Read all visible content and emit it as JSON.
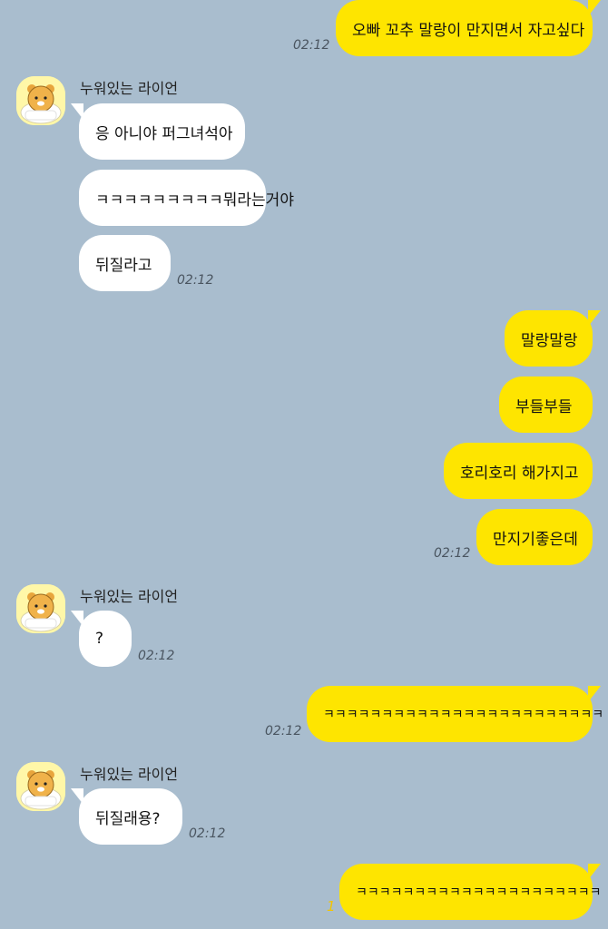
{
  "contact": {
    "name": "누워있는 라이언"
  },
  "messages": [
    {
      "from": "me",
      "text": "오빠 꼬추 말랑이 만지면서 자고싶다",
      "time": "02:12"
    },
    {
      "from": "them",
      "text": "응 아니야 퍼그녀석아"
    },
    {
      "from": "them",
      "text": "ㅋㅋㅋㅋㅋㅋㅋㅋㅋ뭐라는거야"
    },
    {
      "from": "them",
      "text": "뒤질라고",
      "time": "02:12"
    },
    {
      "from": "me",
      "text": "말랑말랑"
    },
    {
      "from": "me",
      "text": "부들부들"
    },
    {
      "from": "me",
      "text": "호리호리 해가지고"
    },
    {
      "from": "me",
      "text": "만지기좋은데",
      "time": "02:12"
    },
    {
      "from": "them",
      "text": "?",
      "time": "02:12"
    },
    {
      "from": "me",
      "text": "ㅋㅋㅋㅋㅋㅋㅋㅋㅋㅋㅋㅋㅋㅋㅋㅋㅋㅋㅋㅋㅋㅋㅋㅋ",
      "time": "02:12"
    },
    {
      "from": "them",
      "text": "뒤질래용?",
      "time": "02:12"
    },
    {
      "from": "me",
      "text": "ㅋㅋㅋㅋㅋㅋㅋㅋㅋㅋㅋㅋㅋㅋㅋㅋㅋㅋㅋㅋㅋ",
      "unread": "1"
    }
  ]
}
